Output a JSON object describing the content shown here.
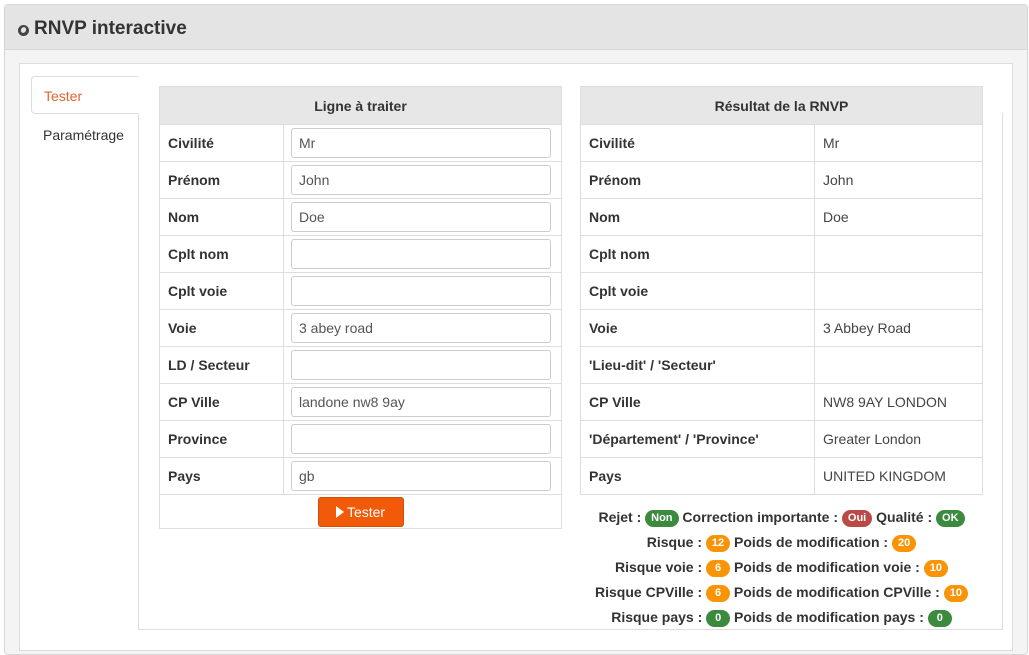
{
  "header": {
    "title": "RNVP interactive",
    "icon": "globe-icon"
  },
  "tabs": [
    {
      "label": "Tester",
      "active": true
    },
    {
      "label": "Paramétrage",
      "active": false
    }
  ],
  "input_table": {
    "title": "Ligne à traiter",
    "rows": [
      {
        "label": "Civilité",
        "value": "Mr"
      },
      {
        "label": "Prénom",
        "value": "John"
      },
      {
        "label": "Nom",
        "value": "Doe"
      },
      {
        "label": "Cplt nom",
        "value": ""
      },
      {
        "label": "Cplt voie",
        "value": ""
      },
      {
        "label": "Voie",
        "value": "3 abey road"
      },
      {
        "label": "LD / Secteur",
        "value": ""
      },
      {
        "label": "CP Ville",
        "value": "landone nw8 9ay"
      },
      {
        "label": "Province",
        "value": ""
      },
      {
        "label": "Pays",
        "value": "gb"
      }
    ],
    "button_label": "Tester"
  },
  "result_table": {
    "title": "Résultat de la RNVP",
    "rows": [
      {
        "label": "Civilité",
        "value": "Mr"
      },
      {
        "label": "Prénom",
        "value": "John"
      },
      {
        "label": "Nom",
        "value": "Doe"
      },
      {
        "label": "Cplt nom",
        "value": ""
      },
      {
        "label": "Cplt voie",
        "value": ""
      },
      {
        "label": "Voie",
        "value": "3 Abbey Road"
      },
      {
        "label": "'Lieu-dit' / 'Secteur'",
        "value": ""
      },
      {
        "label": "CP Ville",
        "value": "NW8 9AY LONDON"
      },
      {
        "label": "'Département' / 'Province'",
        "value": "Greater London"
      },
      {
        "label": "Pays",
        "value": "UNITED KINGDOM"
      }
    ]
  },
  "summary": {
    "rejet": {
      "label": "Rejet",
      "value": "Non",
      "color": "#3b8a3e"
    },
    "correction": {
      "label": "Correction importante",
      "value": "Oui",
      "color": "#b94a48"
    },
    "qualite": {
      "label": "Qualité",
      "value": "OK",
      "color": "#3b8a3e"
    },
    "risque": {
      "label": "Risque",
      "value": "12",
      "color": "#f89406"
    },
    "poids": {
      "label": "Poids de modification",
      "value": "20",
      "color": "#f89406"
    },
    "risque_voie": {
      "label": "Risque voie",
      "value": "6",
      "color": "#f89406"
    },
    "poids_voie": {
      "label": "Poids de modification voie",
      "value": "10",
      "color": "#f89406"
    },
    "risque_cpville": {
      "label": "Risque CPVille",
      "value": "6",
      "color": "#f89406"
    },
    "poids_cpville": {
      "label": "Poids de modification CPVille",
      "value": "10",
      "color": "#f89406"
    },
    "risque_pays": {
      "label": "Risque pays",
      "value": "0",
      "color": "#3b8a3e"
    },
    "poids_pays": {
      "label": "Poids de modification pays",
      "value": "0",
      "color": "#3b8a3e"
    }
  }
}
